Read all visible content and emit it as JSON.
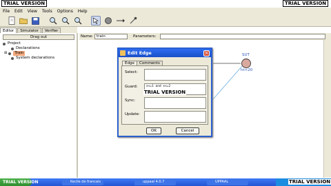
{
  "watermark": "TRIAL VERSION",
  "menu": [
    "File",
    "Edit",
    "View",
    "Tools",
    "Options",
    "Help"
  ],
  "tabs": [
    "Editor",
    "Simulator",
    "Verifier"
  ],
  "left_panel": {
    "drag_out": "Drag out",
    "tree": [
      "Project",
      "Declarations",
      "Train",
      "System declarations"
    ]
  },
  "name_row": {
    "name_label": "Name:",
    "name_value": "train",
    "parameters_label": "Parameters:",
    "parameters_value": ""
  },
  "canvas": {
    "location_name": "SUT",
    "location_invariant": "ht<20"
  },
  "dialog": {
    "title": "Edit Edge",
    "tabs": [
      "Edge",
      "Comments"
    ],
    "fields": [
      {
        "label": "Select:",
        "value": ""
      },
      {
        "label": "Guard:",
        "value": "x<=1 and x<=2"
      },
      {
        "label": "Sync:",
        "value": ""
      },
      {
        "label": "Update:",
        "value": ""
      }
    ],
    "ok": "OK",
    "cancel": "Cancel"
  },
  "taskbar": {
    "start": "TRIAL VERSION",
    "items": [
      "Kecile de francais",
      "uppaal 4.0.7",
      "UPPAAL"
    ],
    "tray_watermark": "TRIAL VERSION"
  },
  "colors": {
    "accent": "#2a5fd0",
    "selected": "#f2a87d",
    "location_fill": "#d9a9a0"
  }
}
